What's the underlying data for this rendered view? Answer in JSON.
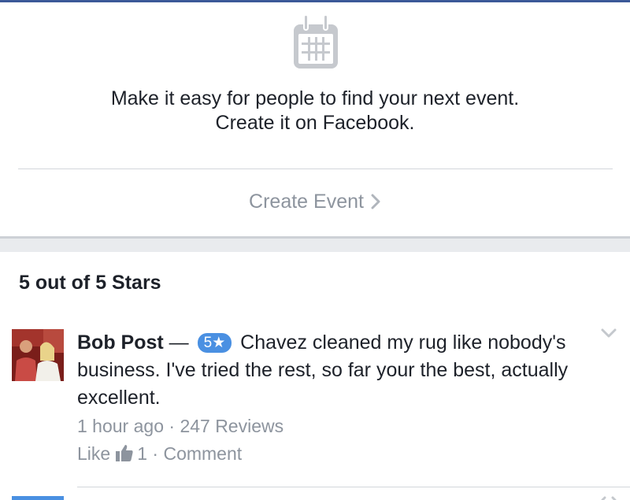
{
  "event": {
    "icon": "calendar-icon",
    "line1": "Make it easy for people to find your next event.",
    "line2": "Create it on Facebook.",
    "create_label": "Create Event"
  },
  "reviews": {
    "heading": "5 out of 5 Stars",
    "items": [
      {
        "name": "Bob Post",
        "dash": " — ",
        "rating_badge": "5★",
        "rating": 5,
        "text": " Chavez cleaned my rug like nobody's business. I've tried the rest, so far your the best, actually excellent.",
        "time": "1 hour ago",
        "sep": " · ",
        "review_count": "247 Reviews",
        "like_label": "Like",
        "like_count": "1",
        "comment_label": "Comment"
      }
    ]
  },
  "colors": {
    "accent": "#3b5998",
    "badge": "#4a90e2",
    "muted": "#8d949e",
    "text": "#1d2129"
  }
}
